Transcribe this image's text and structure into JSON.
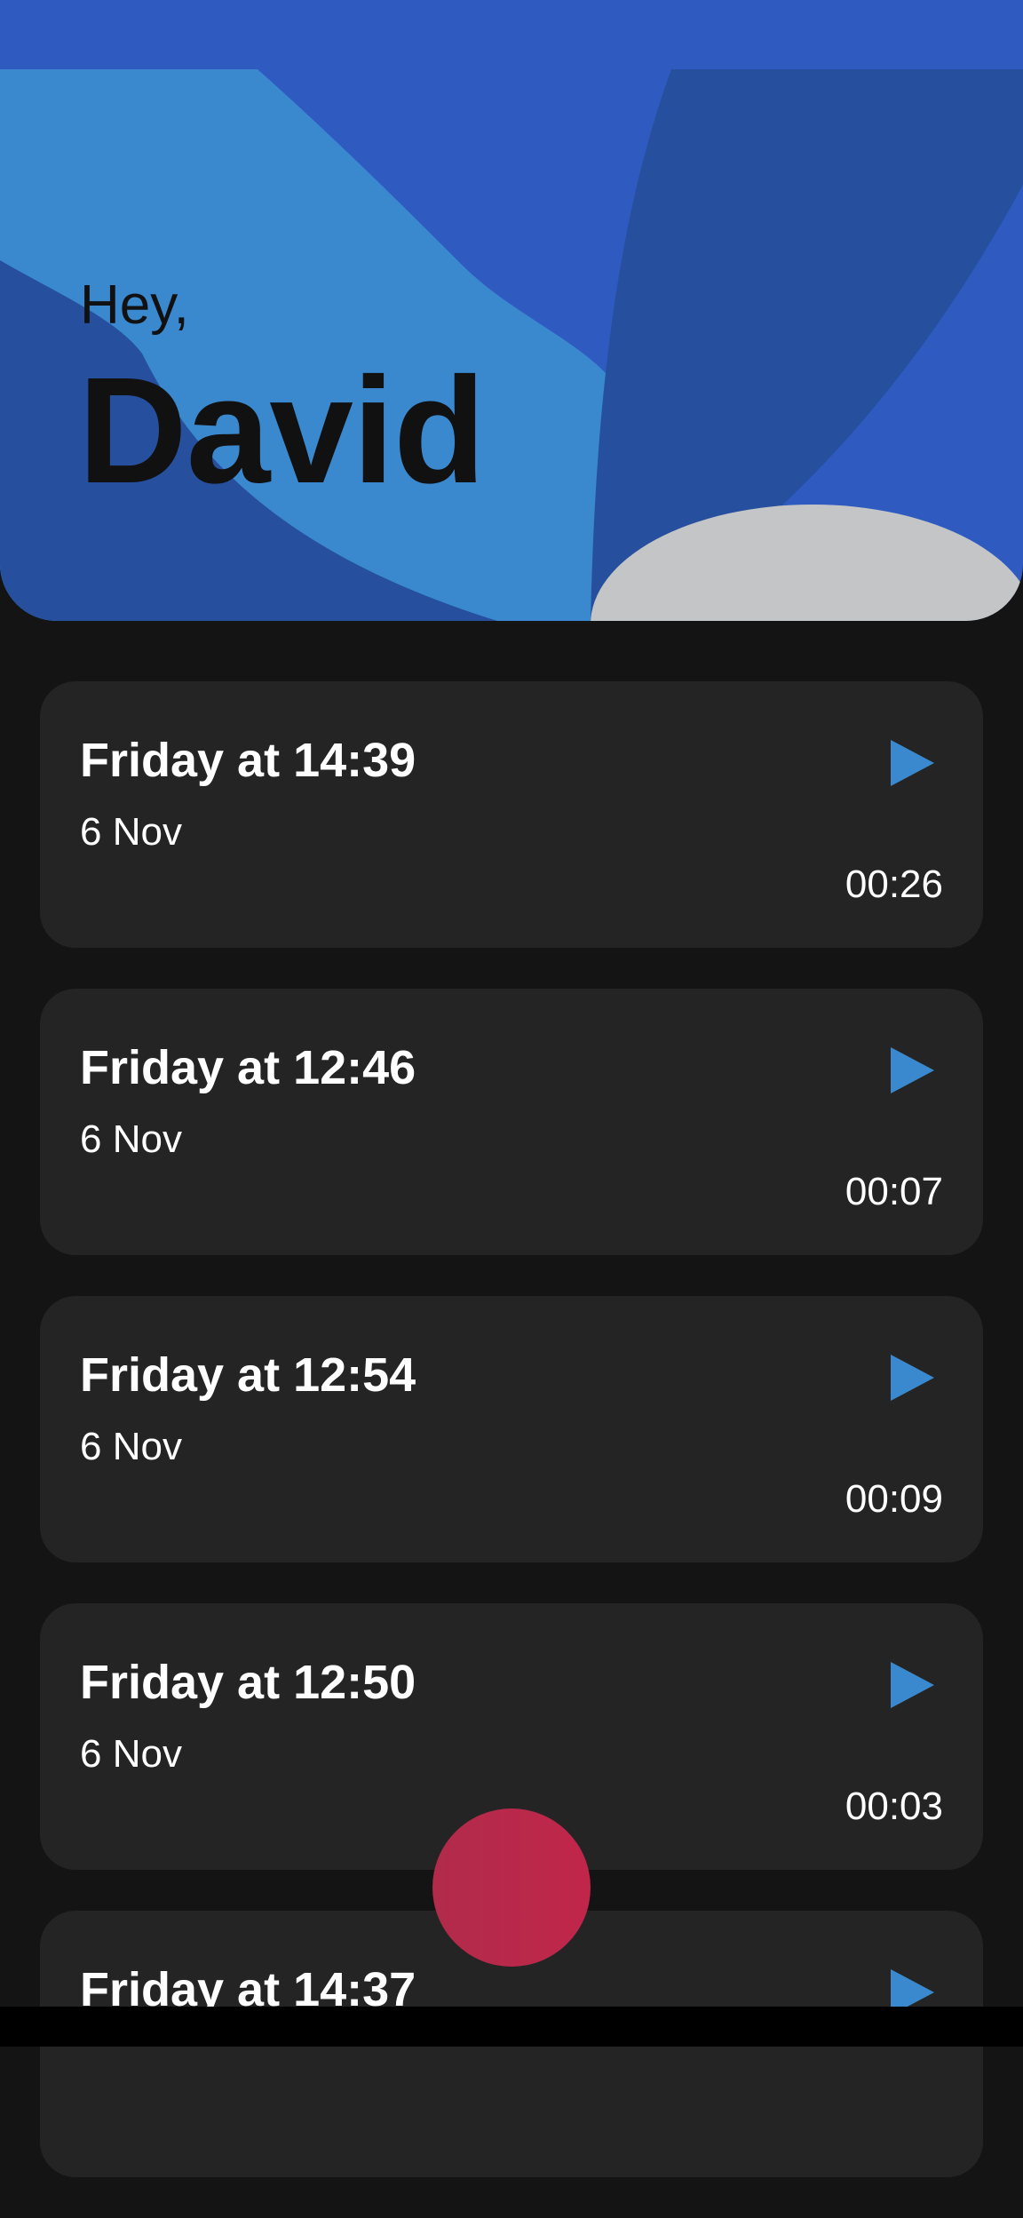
{
  "header": {
    "greeting": "Hey,",
    "name": "David"
  },
  "recordings": [
    {
      "title": "Friday at 14:39",
      "date": "6 Nov",
      "duration": "00:26",
      "action_icon": "play-icon"
    },
    {
      "title": "Friday at 12:46",
      "date": "6 Nov",
      "duration": "00:07",
      "action_icon": "play-icon"
    },
    {
      "title": "Friday at 12:54",
      "date": "6 Nov",
      "duration": "00:09",
      "action_icon": "play-icon"
    },
    {
      "title": "Friday at 12:50",
      "date": "6 Nov",
      "duration": "00:03",
      "action_icon": "play-icon"
    },
    {
      "title": "Friday at 14:37",
      "date": "",
      "duration": "",
      "action_icon": "play-icon"
    }
  ],
  "colors": {
    "status_bar": "#2f5bc0",
    "hero_light": "#3a89cf",
    "hero_dark": "#26509e",
    "accent_play": "#3a89cf",
    "record_button": "#bf264a",
    "background": "#141414",
    "card": "#242424",
    "hero_blob": "#c4c5c6"
  },
  "record_button": {
    "icon": "record-icon"
  }
}
